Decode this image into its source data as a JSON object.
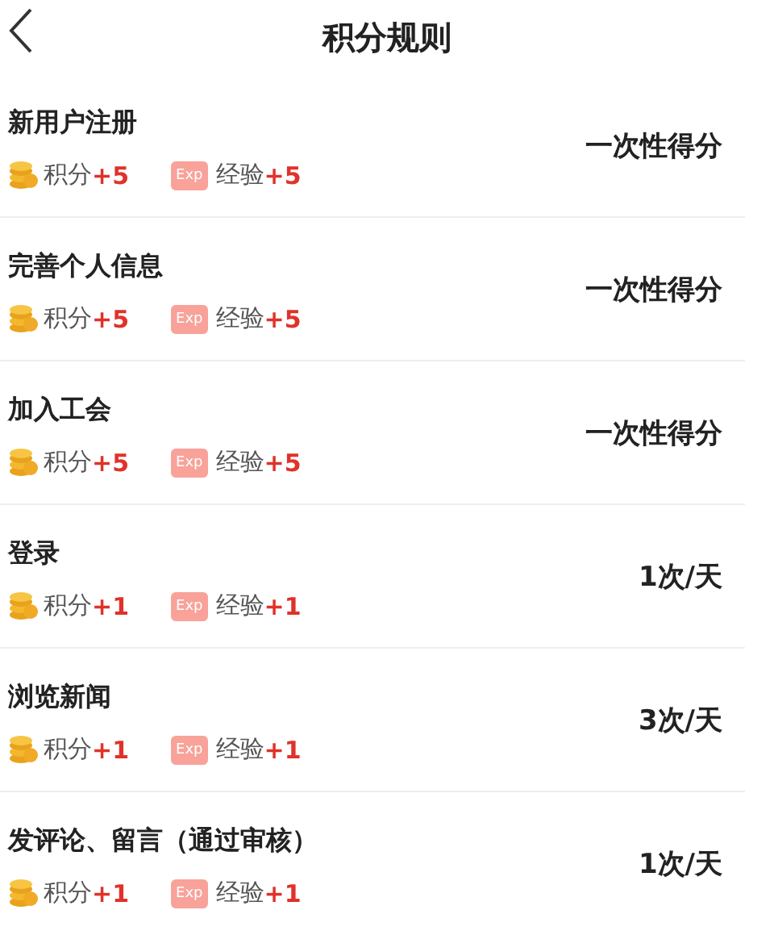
{
  "header": {
    "title": "积分规则"
  },
  "rules": [
    {
      "name": "新用户注册",
      "points_label": "积分",
      "points": "+5",
      "exp_badge": "Exp",
      "exp_label": "经验",
      "exp": "+5",
      "frequency": "一次性得分"
    },
    {
      "name": "完善个人信息",
      "points_label": "积分",
      "points": "+5",
      "exp_badge": "Exp",
      "exp_label": "经验",
      "exp": "+5",
      "frequency": "一次性得分"
    },
    {
      "name": "加入工会",
      "points_label": "积分",
      "points": "+5",
      "exp_badge": "Exp",
      "exp_label": "经验",
      "exp": "+5",
      "frequency": "一次性得分"
    },
    {
      "name": "登录",
      "points_label": "积分",
      "points": "+1",
      "exp_badge": "Exp",
      "exp_label": "经验",
      "exp": "+1",
      "frequency": "1次/天"
    },
    {
      "name": "浏览新闻",
      "points_label": "积分",
      "points": "+1",
      "exp_badge": "Exp",
      "exp_label": "经验",
      "exp": "+1",
      "frequency": "3次/天"
    },
    {
      "name": "发评论、留言（通过审核）",
      "points_label": "积分",
      "points": "+1",
      "exp_badge": "Exp",
      "exp_label": "经验",
      "exp": "+1",
      "frequency": "1次/天"
    }
  ]
}
